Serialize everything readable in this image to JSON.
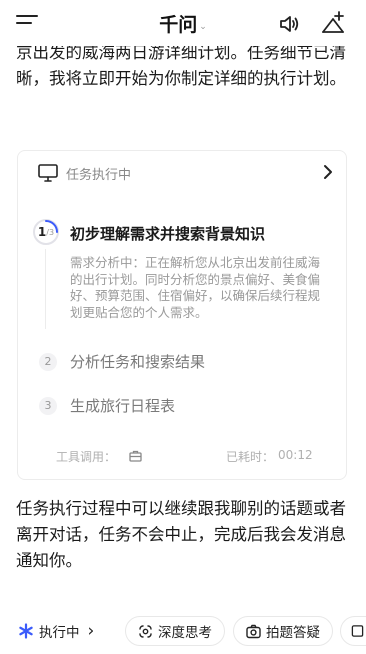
{
  "header": {
    "title": "千问",
    "title_caret": "⌄"
  },
  "intro_text": "京出发的威海两日游详细计划。任务细节已清晰，我将立即开始为你制定详细的执行计划。",
  "task_card": {
    "header_label": "任务执行中",
    "step1": {
      "number": "1",
      "total": "/3",
      "title": "初步理解需求并搜索背景知识",
      "description": "需求分析中：正在解析您从北京出发前往威海的出行计划。同时分析您的景点偏好、美食偏好、预算范围、住宿偏好，以确保后续行程规划更贴合您的个人需求。"
    },
    "step2": {
      "number": "2",
      "title": "分析任务和搜索结果"
    },
    "step3": {
      "number": "3",
      "title": "生成旅行日程表"
    },
    "footer": {
      "tool_label": "工具调用：",
      "elapsed_label": "已耗时：",
      "elapsed_value": "00:12"
    }
  },
  "followup_text": "任务执行过程中可以继续跟我聊别的话题或者离开对话，任务不会中止，完成后我会发消息通知你。",
  "bottom_bar": {
    "running_label": "执行中",
    "running_chevron": "›",
    "deep_think_label": "深度思考",
    "photo_answer_label": "拍题答疑"
  },
  "colors": {
    "accent_blue": "#3b5bfa",
    "text_primary": "#1a1a1a",
    "text_muted": "#9a9a9a"
  },
  "icons": [
    "menu-icon",
    "speaker-icon",
    "add-sparkle-icon",
    "monitor-icon",
    "chevron-right-icon",
    "toolbox-icon",
    "asterisk-icon",
    "deep-think-icon",
    "camera-icon"
  ]
}
